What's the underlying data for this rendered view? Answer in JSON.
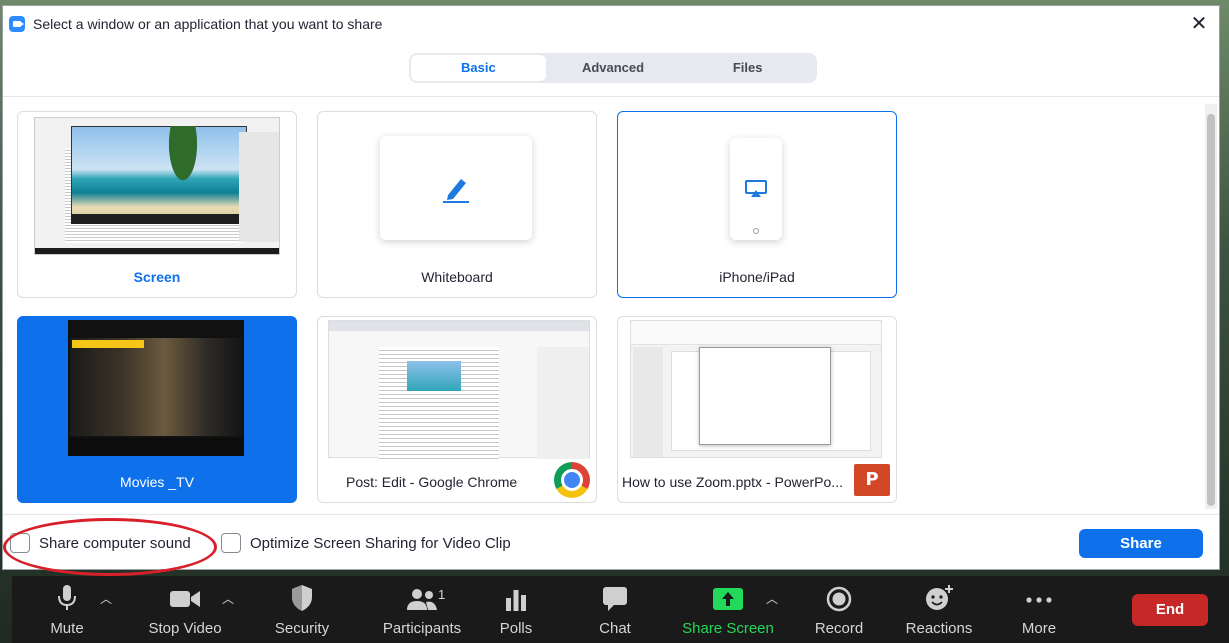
{
  "dialog": {
    "title": "Select a window or an application that you want to share",
    "close_glyph": "✕",
    "tabs": [
      {
        "label": "Basic",
        "active": true
      },
      {
        "label": "Advanced",
        "active": false
      },
      {
        "label": "Files",
        "active": false
      }
    ],
    "tiles": [
      {
        "label": "Screen"
      },
      {
        "label": "Whiteboard"
      },
      {
        "label": "iPhone/iPad"
      },
      {
        "label": "Movies _TV"
      },
      {
        "label": "Post: Edit - Google Chrome"
      },
      {
        "label": "How to use Zoom.pptx - PowerPo..."
      }
    ],
    "options": {
      "share_sound": "Share computer sound",
      "optimize_video": "Optimize Screen Sharing for Video Clip"
    },
    "share_button": "Share",
    "ppt_badge": "P"
  },
  "toolbar": {
    "items": [
      {
        "label": "Mute",
        "icon": "microphone-icon"
      },
      {
        "label": "Stop Video",
        "icon": "video-camera-icon"
      },
      {
        "label": "Security",
        "icon": "shield-icon"
      },
      {
        "label": "Participants",
        "icon": "participants-icon",
        "count": "1"
      },
      {
        "label": "Polls",
        "icon": "polls-icon"
      },
      {
        "label": "Chat",
        "icon": "chat-icon"
      },
      {
        "label": "Share Screen",
        "icon": "share-screen-icon"
      },
      {
        "label": "Record",
        "icon": "record-icon"
      },
      {
        "label": "Reactions",
        "icon": "reactions-icon"
      },
      {
        "label": "More",
        "icon": "more-icon"
      }
    ],
    "end_label": "End"
  },
  "colors": {
    "accent": "#0e71eb",
    "share_green": "#23d959",
    "end_red": "#c62828",
    "annotation_red": "#d9202a"
  }
}
